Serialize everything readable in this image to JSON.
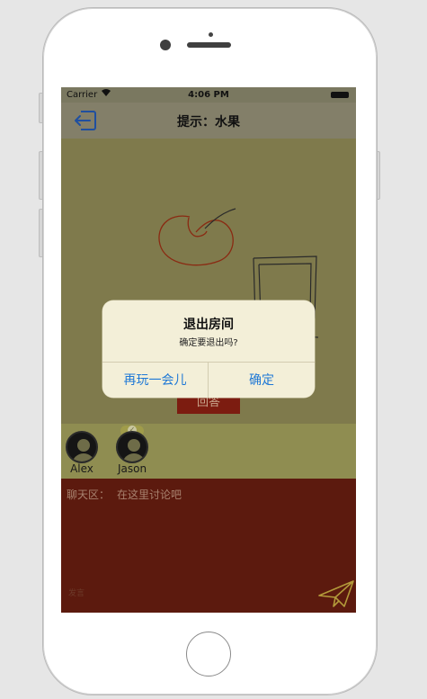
{
  "status_bar": {
    "carrier": "Carrier",
    "time": "4:06 PM"
  },
  "nav": {
    "hint_label": "提示：",
    "hint_value": "水果"
  },
  "canvas": {
    "answer_button": "回答"
  },
  "players": [
    {
      "name": "Alex",
      "selected": false
    },
    {
      "name": "Jason",
      "selected": true
    }
  ],
  "chat": {
    "label": "聊天区：",
    "placeholder": "在这里讨论吧",
    "input_hint": "发言"
  },
  "dialog": {
    "title": "退出房间",
    "message": "确定要退出吗?",
    "cancel_label": "再玩一会儿",
    "confirm_label": "确定"
  },
  "colors": {
    "accent": "#1e78d6",
    "chat_bg": "#5c1a0e",
    "players_bg": "#8f8d51",
    "dialog_bg": "#f3efd8"
  }
}
